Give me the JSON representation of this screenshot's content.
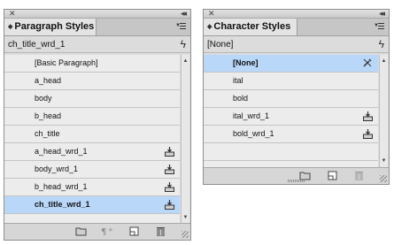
{
  "paragraph_panel": {
    "title": "Paragraph Styles",
    "current_style": "ch_title_wrd_1",
    "items": [
      {
        "label": "[Basic Paragraph]",
        "imported": false,
        "selected": false
      },
      {
        "label": "a_head",
        "imported": false,
        "selected": false
      },
      {
        "label": "body",
        "imported": false,
        "selected": false
      },
      {
        "label": "b_head",
        "imported": false,
        "selected": false
      },
      {
        "label": "ch_title",
        "imported": false,
        "selected": false
      },
      {
        "label": "a_head_wrd_1",
        "imported": true,
        "selected": false
      },
      {
        "label": "body_wrd_1",
        "imported": true,
        "selected": false
      },
      {
        "label": "b_head_wrd_1",
        "imported": true,
        "selected": false
      },
      {
        "label": "ch_title_wrd_1",
        "imported": true,
        "selected": true
      }
    ]
  },
  "character_panel": {
    "title": "Character Styles",
    "current_style": "[None]",
    "items": [
      {
        "label": "[None]",
        "imported": false,
        "selected": true
      },
      {
        "label": "ital",
        "imported": false,
        "selected": false
      },
      {
        "label": "bold",
        "imported": false,
        "selected": false
      },
      {
        "label": "ital_wrd_1",
        "imported": true,
        "selected": false
      },
      {
        "label": "bold_wrd_1",
        "imported": true,
        "selected": false
      }
    ]
  },
  "colors": {
    "panel_bg": "#dcdcdc",
    "row_bg": "#ececec",
    "selected_row": "#b9d7f9"
  },
  "icons": {
    "close": "close-icon",
    "collapse": "collapse-icon",
    "menu": "panel-menu-icon",
    "lightning": "lightning-icon",
    "import": "imported-style-icon",
    "new_group": "folder-icon",
    "clear_overrides": "clear-overrides-icon",
    "new_style": "new-style-icon",
    "delete": "trash-icon"
  }
}
